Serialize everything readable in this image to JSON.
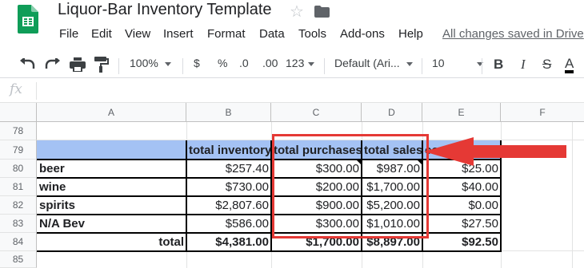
{
  "app": {
    "doc_title": "Liquor-Bar Inventory Template",
    "menu": [
      "File",
      "Edit",
      "View",
      "Insert",
      "Format",
      "Data",
      "Tools",
      "Add-ons",
      "Help"
    ],
    "save_status": "All changes saved in Drive"
  },
  "toolbar": {
    "zoom": "100%",
    "currency": "$",
    "percent": "%",
    "decrease_decimal": ".0",
    "increase_decimal": ".00",
    "more_formats": "123",
    "font": "Default (Ari...",
    "font_size": "10",
    "bold": "B",
    "italic": "I",
    "strikethrough": "S",
    "text_color": "A"
  },
  "formula_bar": {
    "fx": "fx",
    "value": ""
  },
  "sheet": {
    "columns": [
      "A",
      "B",
      "C",
      "D",
      "E",
      "F"
    ],
    "rows": [
      "78",
      "79",
      "80",
      "81",
      "82",
      "83",
      "84",
      "85"
    ],
    "header_row": {
      "b": "total inventory",
      "c": "total purchases",
      "d": "total sales",
      "e": "comp"
    },
    "data_rows": [
      {
        "a": "beer",
        "b": "$257.40",
        "c": "$300.00",
        "d": "$987.00",
        "e": "$25.00"
      },
      {
        "a": "wine",
        "b": "$730.00",
        "c": "$200.00",
        "d": "$1,700.00",
        "e": "$40.00"
      },
      {
        "a": "spirits",
        "b": "$2,807.60",
        "c": "$900.00",
        "d": "$5,200.00",
        "e": "$0.00"
      },
      {
        "a": "N/A Bev",
        "b": "$586.00",
        "c": "$300.00",
        "d": "$1,010.00",
        "e": "$27.50"
      }
    ],
    "total_row": {
      "a": "total",
      "b": "$4,381.00",
      "c": "$1,700.00",
      "d": "$8,897.00",
      "e": "$92.50"
    }
  },
  "colors": {
    "header_fill": "#a4c2f4",
    "highlight": "#e53935",
    "sheets_green": "#0f9d58"
  },
  "icons": [
    "sheets-logo-icon",
    "star-icon",
    "folder-icon",
    "undo-icon",
    "redo-icon",
    "print-icon",
    "paint-format-icon",
    "red-arrow-icon"
  ]
}
